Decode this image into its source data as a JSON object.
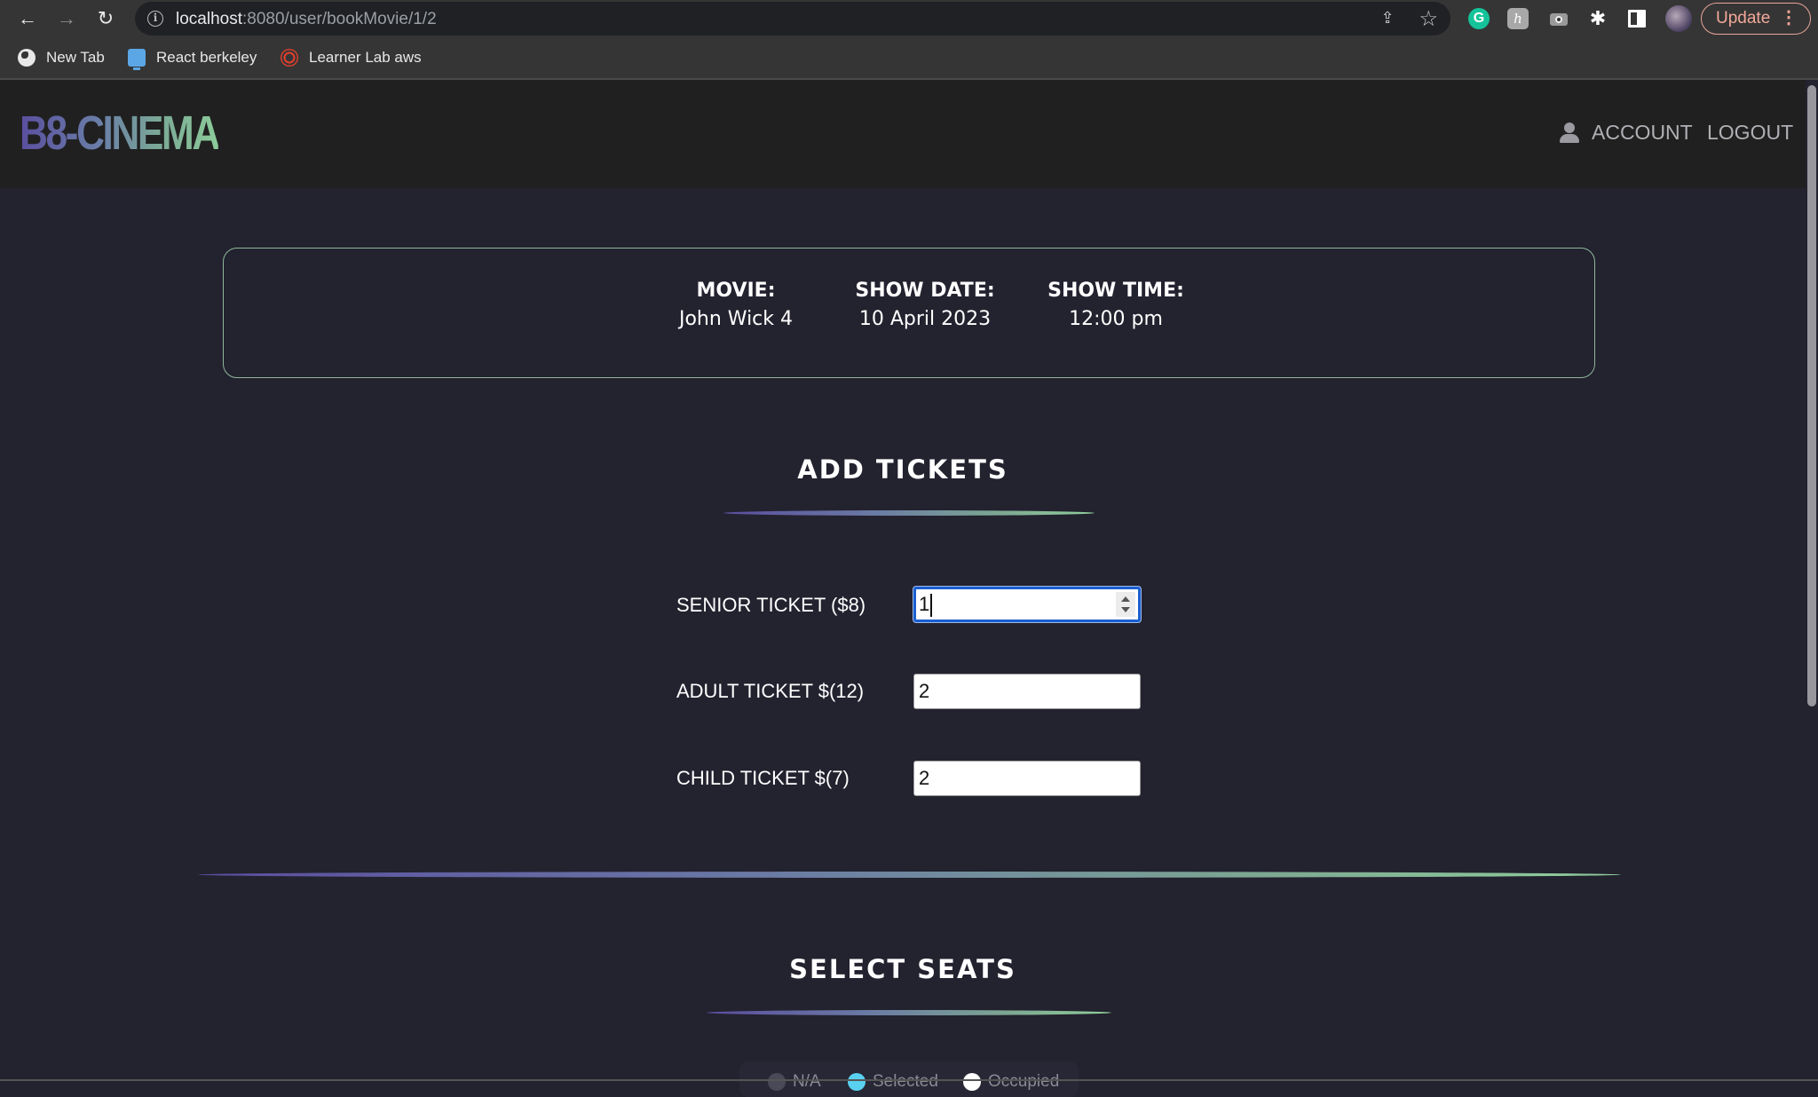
{
  "browser": {
    "url_host": "localhost",
    "url_path": ":8080/user/bookMovie/1/2",
    "update_label": "Update",
    "bookmarks": [
      {
        "label": "New Tab",
        "icon": "globe-icon"
      },
      {
        "label": "React berkeley",
        "icon": "monitor-icon"
      },
      {
        "label": "Learner Lab aws",
        "icon": "canvas-icon"
      }
    ],
    "extensions": [
      "grammarly-icon",
      "honey-icon",
      "camera-icon",
      "puzzle-icon",
      "side-panel-icon",
      "profile-avatar"
    ]
  },
  "navbar": {
    "logo": "B8-CINEMA",
    "account_label": "ACCOUNT",
    "logout_label": "LOGOUT"
  },
  "show_info": {
    "movie_label": "MOVIE:",
    "movie_value": "John Wick 4",
    "date_label": "SHOW DATE:",
    "date_value": "10 April 2023",
    "time_label": "SHOW TIME:",
    "time_value": "12:00 pm"
  },
  "tickets": {
    "title": "ADD TICKETS",
    "rows": [
      {
        "label": "SENIOR TICKET ($8)",
        "value": "1"
      },
      {
        "label": "ADULT TICKET $(12)",
        "value": "2"
      },
      {
        "label": "CHILD TICKET $(7)",
        "value": "2"
      }
    ]
  },
  "seats": {
    "title": "SELECT SEATS",
    "legend": [
      {
        "label": "N/A",
        "color": "#4a4958"
      },
      {
        "label": "Selected",
        "color": "#5ad0f0"
      },
      {
        "label": "Occupied",
        "color": "#ffffff"
      }
    ]
  },
  "colors": {
    "page_bg": "#23222f",
    "navbar_bg": "#202020",
    "accent_purple": "#5b4ea0",
    "accent_green": "#90d09c",
    "focus_blue": "#1a5fd0"
  }
}
